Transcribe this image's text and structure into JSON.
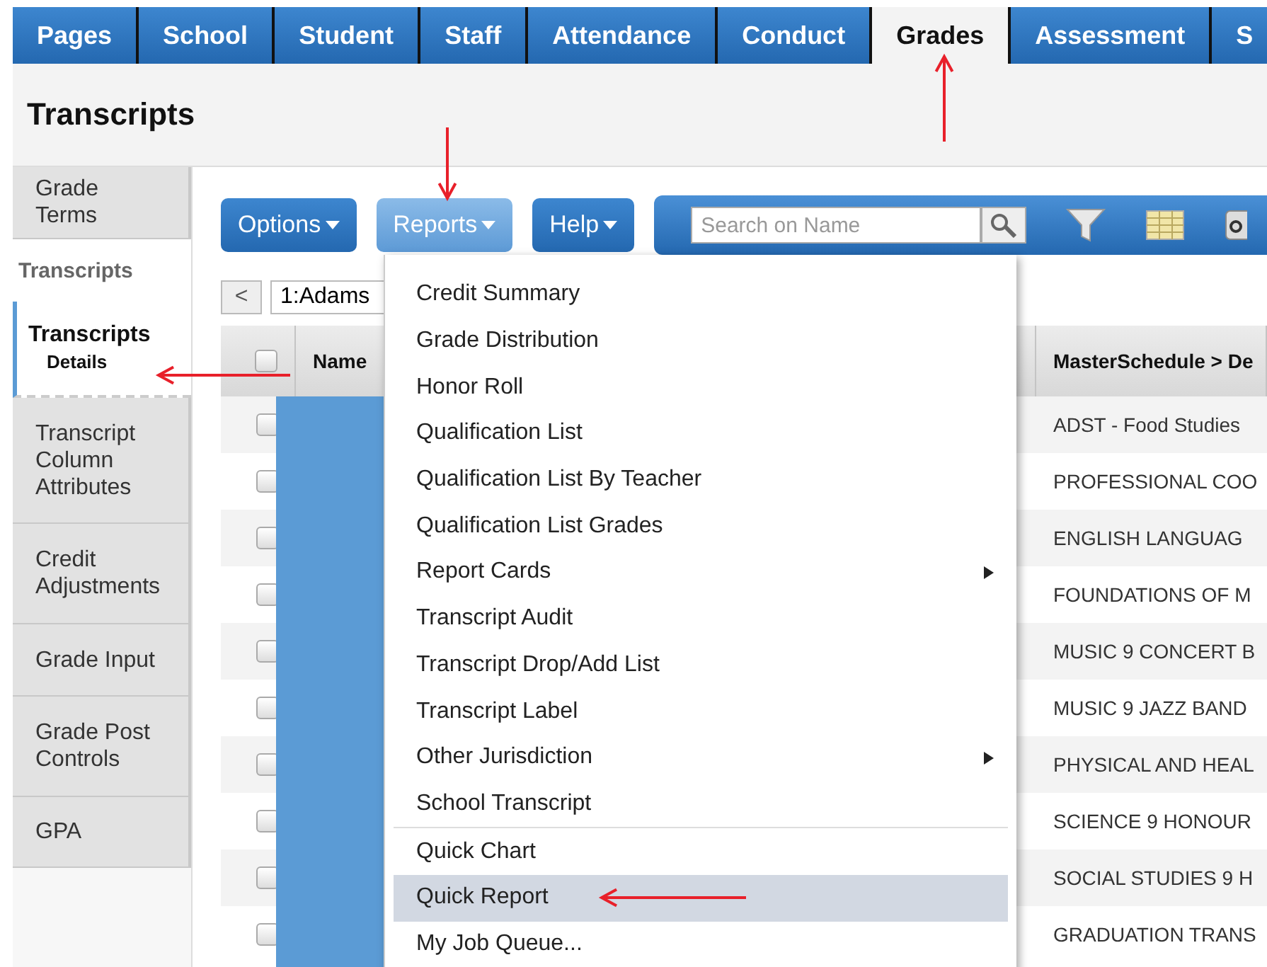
{
  "tabs": [
    {
      "label": "Pages",
      "selected": false
    },
    {
      "label": "School",
      "selected": false
    },
    {
      "label": "Student",
      "selected": false
    },
    {
      "label": "Staff",
      "selected": false
    },
    {
      "label": "Attendance",
      "selected": false
    },
    {
      "label": "Conduct",
      "selected": false
    },
    {
      "label": "Grades",
      "selected": true
    },
    {
      "label": "Assessment",
      "selected": false
    },
    {
      "label": "S",
      "selected": false
    }
  ],
  "page_title": "Transcripts",
  "sidebar": {
    "items": [
      {
        "kind": "item",
        "label": "Grade Terms",
        "selected": false
      },
      {
        "kind": "header",
        "label": "Transcripts"
      },
      {
        "kind": "item",
        "label": "Transcripts",
        "sublabel": "Details",
        "selected": true
      },
      {
        "kind": "item",
        "label": "Transcript Column Attributes",
        "selected": false
      },
      {
        "kind": "item",
        "label": "Credit Adjustments",
        "selected": false
      },
      {
        "kind": "item",
        "label": "Grade Input",
        "selected": false
      },
      {
        "kind": "item",
        "label": "Grade Post Controls",
        "selected": false
      },
      {
        "kind": "item",
        "label": "GPA",
        "selected": false
      }
    ]
  },
  "toolbar": {
    "buttons": [
      {
        "label": "Options",
        "selected": false
      },
      {
        "label": "Reports",
        "selected": true
      },
      {
        "label": "Help",
        "selected": false
      }
    ],
    "search": {
      "placeholder": "Search on Name"
    }
  },
  "navigator": {
    "previous": "<",
    "record": "1:Adams"
  },
  "table": {
    "header_checked": false,
    "columns": [
      "Name",
      "MasterSchedule > De"
    ],
    "rows": [
      {
        "checked": false,
        "course": "ADST - Food Studies"
      },
      {
        "checked": false,
        "course": "PROFESSIONAL COO"
      },
      {
        "checked": false,
        "course": "ENGLISH LANGUAG"
      },
      {
        "checked": false,
        "course": "FOUNDATIONS OF M"
      },
      {
        "checked": false,
        "course": "MUSIC 9 CONCERT B"
      },
      {
        "checked": false,
        "course": "MUSIC 9 JAZZ BAND"
      },
      {
        "checked": false,
        "course": "PHYSICAL AND HEAL"
      },
      {
        "checked": false,
        "course": "SCIENCE 9 HONOUR"
      },
      {
        "checked": false,
        "course": "SOCIAL STUDIES 9 H"
      },
      {
        "checked": false,
        "course": "GRADUATION TRANS"
      }
    ]
  },
  "reports_menu": {
    "groups": [
      [
        {
          "label": "Credit Summary",
          "submenu": false,
          "selected": false
        },
        {
          "label": "Grade Distribution",
          "submenu": false,
          "selected": false
        },
        {
          "label": "Honor Roll",
          "submenu": false,
          "selected": false
        },
        {
          "label": "Qualification List",
          "submenu": false,
          "selected": false
        },
        {
          "label": "Qualification List By Teacher",
          "submenu": false,
          "selected": false
        },
        {
          "label": "Qualification List Grades",
          "submenu": false,
          "selected": false
        },
        {
          "label": "Report Cards",
          "submenu": true,
          "selected": false
        },
        {
          "label": "Transcript Audit",
          "submenu": false,
          "selected": false
        },
        {
          "label": "Transcript Drop/Add List",
          "submenu": false,
          "selected": false
        },
        {
          "label": "Transcript Label",
          "submenu": false,
          "selected": false
        },
        {
          "label": "Other Jurisdiction",
          "submenu": true,
          "selected": false
        },
        {
          "label": "School Transcript",
          "submenu": false,
          "selected": false
        }
      ],
      [
        {
          "label": "Quick Chart",
          "submenu": false,
          "selected": false
        },
        {
          "label": "Quick Report",
          "submenu": false,
          "selected": true
        },
        {
          "label": "My Job Queue...",
          "submenu": false,
          "selected": false
        }
      ]
    ]
  }
}
